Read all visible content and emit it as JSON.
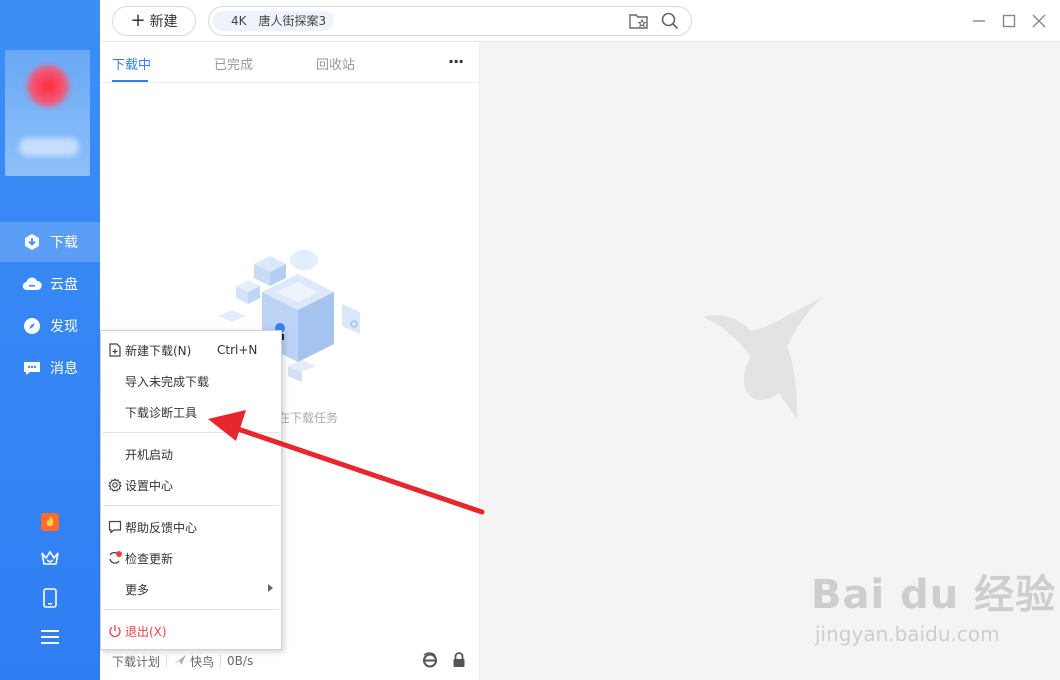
{
  "topbar": {
    "new_label": "新建",
    "search_chip": "4K　唐人街探案3"
  },
  "sidebar": {
    "items": [
      {
        "label": "下载",
        "icon": "download-icon"
      },
      {
        "label": "云盘",
        "icon": "cloud-icon"
      },
      {
        "label": "发现",
        "icon": "compass-icon"
      },
      {
        "label": "消息",
        "icon": "message-icon"
      }
    ],
    "bottom_icons": [
      "hot-icon",
      "vip-crown-icon",
      "phone-icon",
      "menu-icon"
    ]
  },
  "tabs": [
    "下载中",
    "已完成",
    "回收站"
  ],
  "empty_text": "在下载任务",
  "status": {
    "plan": "下载计划",
    "mode": "快鸟",
    "speed": "0B/s"
  },
  "menu": {
    "items": [
      {
        "label": "新建下载(N)",
        "shortcut": "Ctrl+N"
      },
      {
        "label": "导入未完成下载"
      },
      {
        "label": "下载诊断工具"
      },
      {
        "label": "开机启动"
      },
      {
        "label": "设置中心"
      },
      {
        "label": "帮助反馈中心"
      },
      {
        "label": "检查更新"
      },
      {
        "label": "更多"
      },
      {
        "label": "退出(X)"
      }
    ]
  },
  "watermark": {
    "main": "Bai du 经验",
    "sub": "jingyan.baidu.com"
  },
  "colors": {
    "accent": "#2f7ff3",
    "sidebar": "#3c8ef6",
    "danger": "#e5434a",
    "annotation": "#e8262d"
  }
}
